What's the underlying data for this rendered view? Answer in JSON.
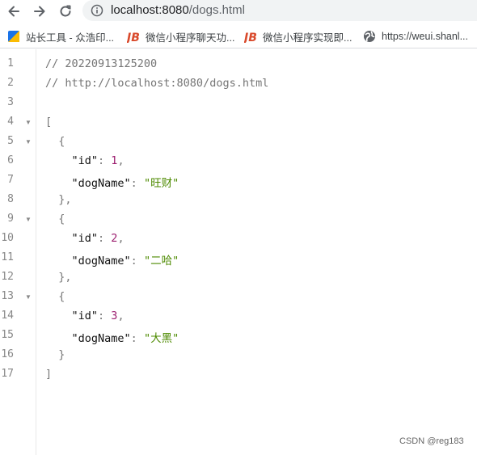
{
  "browser": {
    "address": {
      "host": "localhost:8080",
      "path": "/dogs.html"
    },
    "bookmarks": [
      {
        "label": "站长工具 - 众浩印...",
        "icon": "chinaz-icon"
      },
      {
        "label": "微信小程序聊天功...",
        "icon": "jb-icon"
      },
      {
        "label": "微信小程序实现即...",
        "icon": "jb-icon"
      },
      {
        "label": "https://weui.shanl...",
        "icon": "globe-icon"
      }
    ]
  },
  "viewer": {
    "line_numbers": [
      "1",
      "2",
      "3",
      "4",
      "5",
      "6",
      "7",
      "8",
      "9",
      "10",
      "11",
      "12",
      "13",
      "14",
      "15",
      "16",
      "17"
    ],
    "comment_timestamp": "// 20220913125200",
    "comment_url": "// http://localhost:8080/dogs.html",
    "dogs": [
      {
        "id": "1",
        "dogName": "\"旺财\""
      },
      {
        "id": "2",
        "dogName": "\"二哈\""
      },
      {
        "id": "3",
        "dogName": "\"大黑\""
      }
    ],
    "keys": {
      "id": "\"id\"",
      "dogName": "\"dogName\""
    }
  },
  "watermark": "CSDN @reg183",
  "colors": {
    "number": "#9c1e6f",
    "string": "#4d8a00",
    "comment": "#757575"
  }
}
